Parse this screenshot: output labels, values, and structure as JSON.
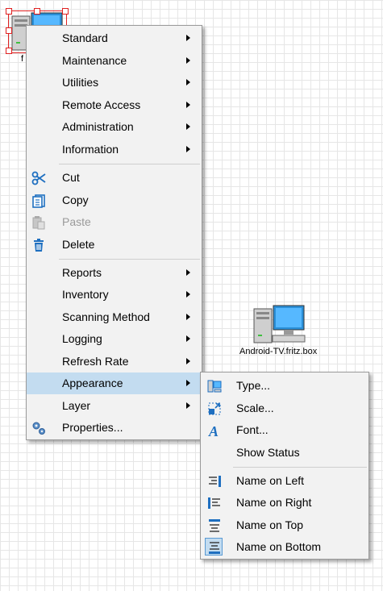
{
  "canvas": {
    "devices": [
      {
        "label": "f",
        "icon": "computer-icon"
      },
      {
        "label": "Android-TV.fritz.box",
        "icon": "computer-icon"
      }
    ]
  },
  "context_menu": {
    "groups": [
      [
        {
          "label": "Standard",
          "submenu": true
        },
        {
          "label": "Maintenance",
          "submenu": true
        },
        {
          "label": "Utilities",
          "submenu": true
        },
        {
          "label": "Remote Access",
          "submenu": true
        },
        {
          "label": "Administration",
          "submenu": true
        },
        {
          "label": "Information",
          "submenu": true
        }
      ],
      [
        {
          "label": "Cut",
          "icon": "scissors-icon"
        },
        {
          "label": "Copy",
          "icon": "copy-icon"
        },
        {
          "label": "Paste",
          "icon": "paste-icon",
          "disabled": true
        },
        {
          "label": "Delete",
          "icon": "trash-icon"
        }
      ],
      [
        {
          "label": "Reports",
          "submenu": true
        },
        {
          "label": "Inventory",
          "submenu": true
        },
        {
          "label": "Scanning Method",
          "submenu": true
        },
        {
          "label": "Logging",
          "submenu": true
        },
        {
          "label": "Refresh Rate",
          "submenu": true
        },
        {
          "label": "Appearance",
          "submenu": true,
          "highlighted": true
        },
        {
          "label": "Layer",
          "submenu": true
        },
        {
          "label": "Properties...",
          "icon": "gears-icon"
        }
      ]
    ]
  },
  "appearance_submenu": {
    "groups": [
      [
        {
          "label": "Type...",
          "icon": "device-type-icon"
        },
        {
          "label": "Scale...",
          "icon": "scale-icon"
        },
        {
          "label": "Font...",
          "icon": "font-icon"
        },
        {
          "label": "Show Status"
        }
      ],
      [
        {
          "label": "Name on Left",
          "icon": "align-left-icon"
        },
        {
          "label": "Name on Right",
          "icon": "align-right-icon"
        },
        {
          "label": "Name on Top",
          "icon": "align-top-icon"
        },
        {
          "label": "Name on Bottom",
          "icon": "align-bottom-icon",
          "checked": true
        }
      ]
    ]
  },
  "colors": {
    "highlight": "#c3dcf0",
    "selection": "#e02020",
    "icon_blue": "#1e6fc0"
  }
}
